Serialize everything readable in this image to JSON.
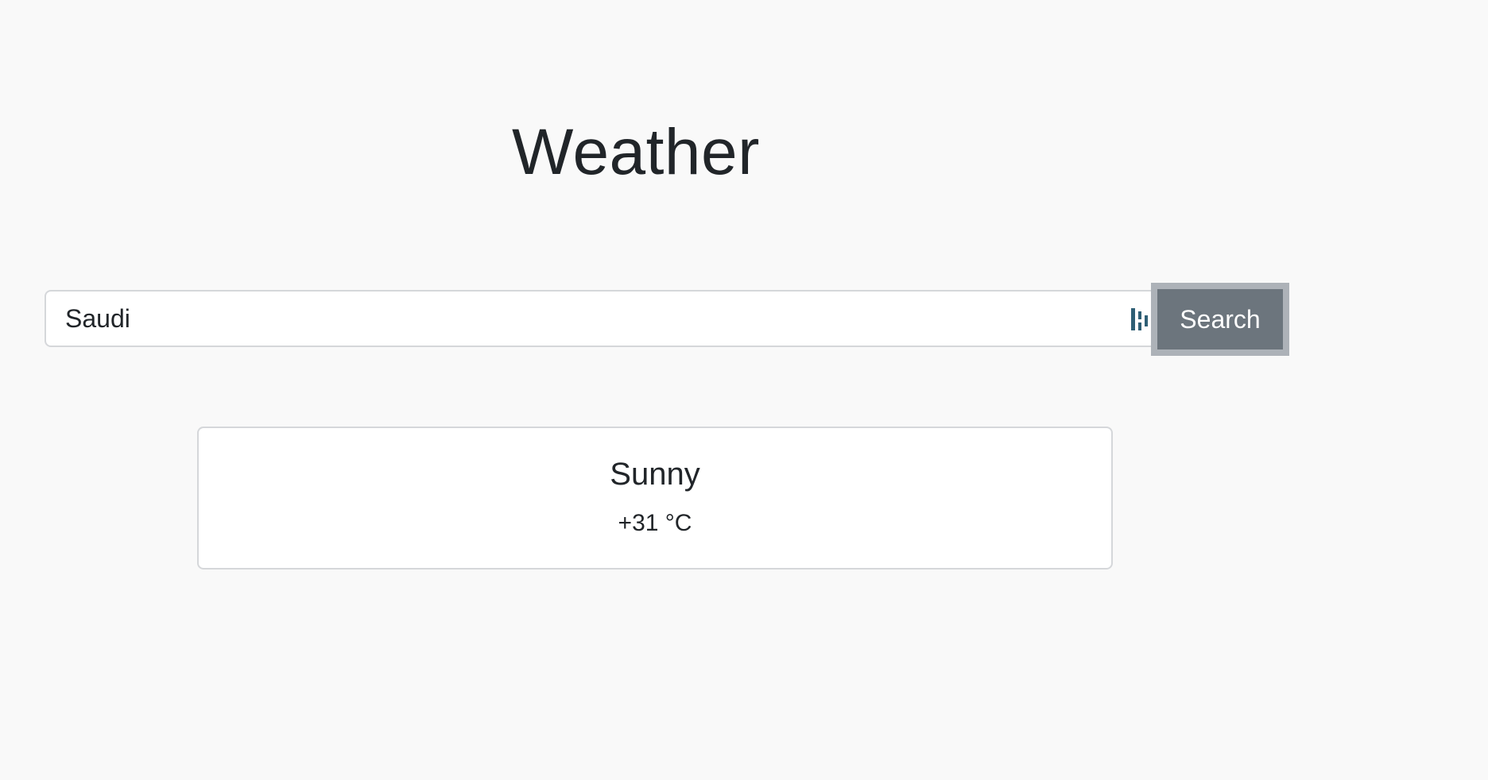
{
  "page": {
    "title": "Weather"
  },
  "search": {
    "value": "Saudi",
    "button_label": "Search",
    "extension_icon": "password-manager-icon"
  },
  "result": {
    "condition": "Sunny",
    "temperature": "+31 °C"
  },
  "colors": {
    "background": "#f9f9f9",
    "button": "#6c757d",
    "button_focus_ring": "#adb2b8",
    "text": "#212529",
    "icon_accent": "#2f5f75"
  }
}
